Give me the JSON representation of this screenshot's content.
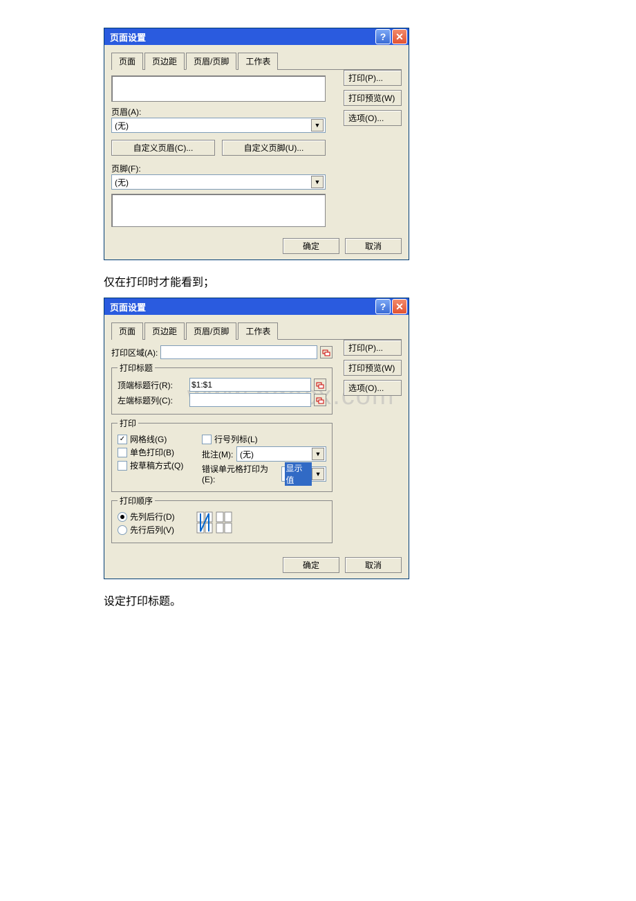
{
  "dialog_title": "页面设置",
  "tabs": [
    "页面",
    "页边距",
    "页眉/页脚",
    "工作表"
  ],
  "side_buttons": {
    "print": "打印(P)...",
    "preview": "打印预览(W)",
    "options": "选项(O)..."
  },
  "header_label": "页眉(A):",
  "header_value": "(无)",
  "footer_label": "页脚(F):",
  "footer_value": "(无)",
  "custom_header_btn": "自定义页眉(C)...",
  "custom_footer_btn": "自定义页脚(U)...",
  "ok_btn": "确定",
  "cancel_btn": "取消",
  "caption1": "仅在打印时才能看到；",
  "caption2": "设定打印标题。",
  "print_area_label": "打印区域(A):",
  "print_titles_legend": "打印标题",
  "top_row_label": "顶端标题行(R):",
  "top_row_value": "$1:$1",
  "left_col_label": "左端标题列(C):",
  "left_col_value": "",
  "print_legend": "打印",
  "gridlines_label": "网格线(G)",
  "row_col_head_label": "行号列标(L)",
  "monochrome_label": "单色打印(B)",
  "draft_label": "按草稿方式(Q)",
  "comments_label": "批注(M):",
  "comments_value": "(无)",
  "cell_errors_label": "错误单元格打印为(E):",
  "cell_errors_value": "显示值",
  "order_legend": "打印顺序",
  "order_down_label": "先列后行(D)",
  "order_over_label": "先行后列(V)",
  "watermark": "www.bdocx.com"
}
